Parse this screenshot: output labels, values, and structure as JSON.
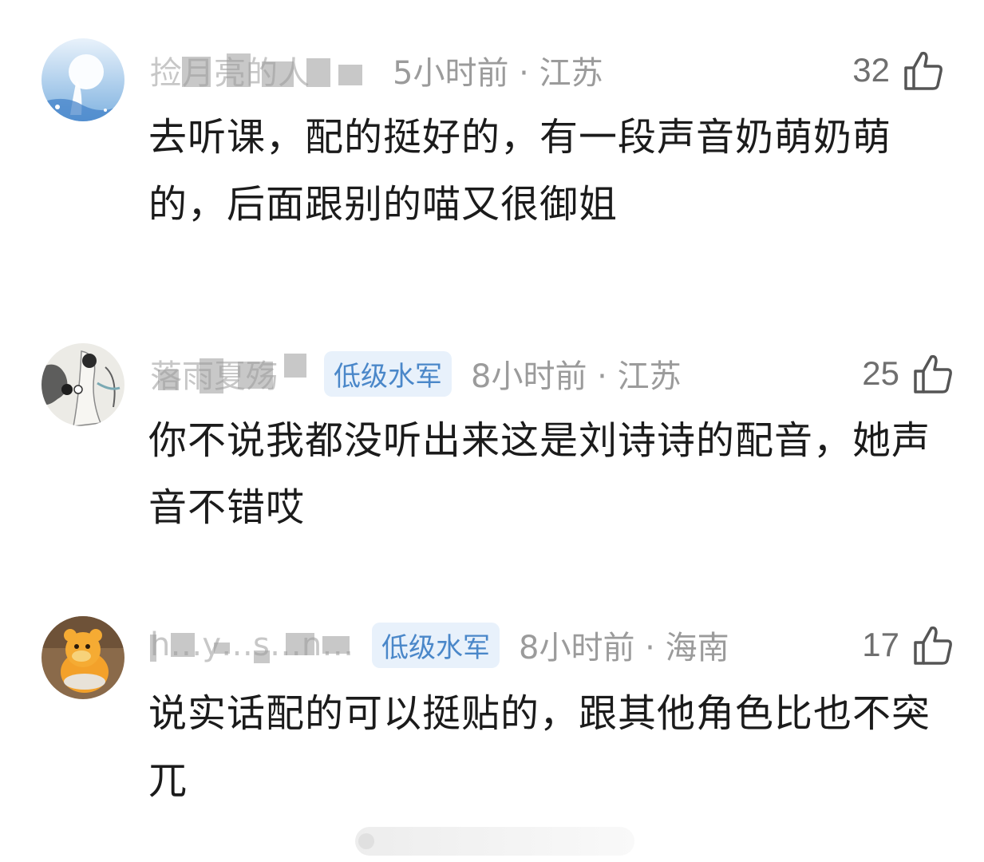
{
  "comments": [
    {
      "username": "捡月亮的人",
      "badge": "",
      "time": "5小时前",
      "location": "江苏",
      "likes": "32",
      "text": "去听课，配的挺好的，有一段声音奶萌奶萌的，后面跟别的喵又很御姐",
      "avatar": "avatar-moon-icon"
    },
    {
      "username": "落雨夏殇",
      "badge": "低级水军",
      "time": "8小时前",
      "location": "江苏",
      "likes": "25",
      "text": "你不说我都没听出来这是刘诗诗的配音，她声音不错哎",
      "avatar": "avatar-ink-painting-icon"
    },
    {
      "username": "h…y…s…n…",
      "badge": "低级水军",
      "time": "8小时前",
      "location": "海南",
      "likes": "17",
      "text": "说实话配的可以挺贴的，跟其他角色比也不突兀",
      "avatar": "avatar-toy-icon"
    }
  ],
  "colors": {
    "badge_bg": "#e8f1fb",
    "badge_text": "#4a87c9",
    "meta_text": "#9b9b9b"
  }
}
